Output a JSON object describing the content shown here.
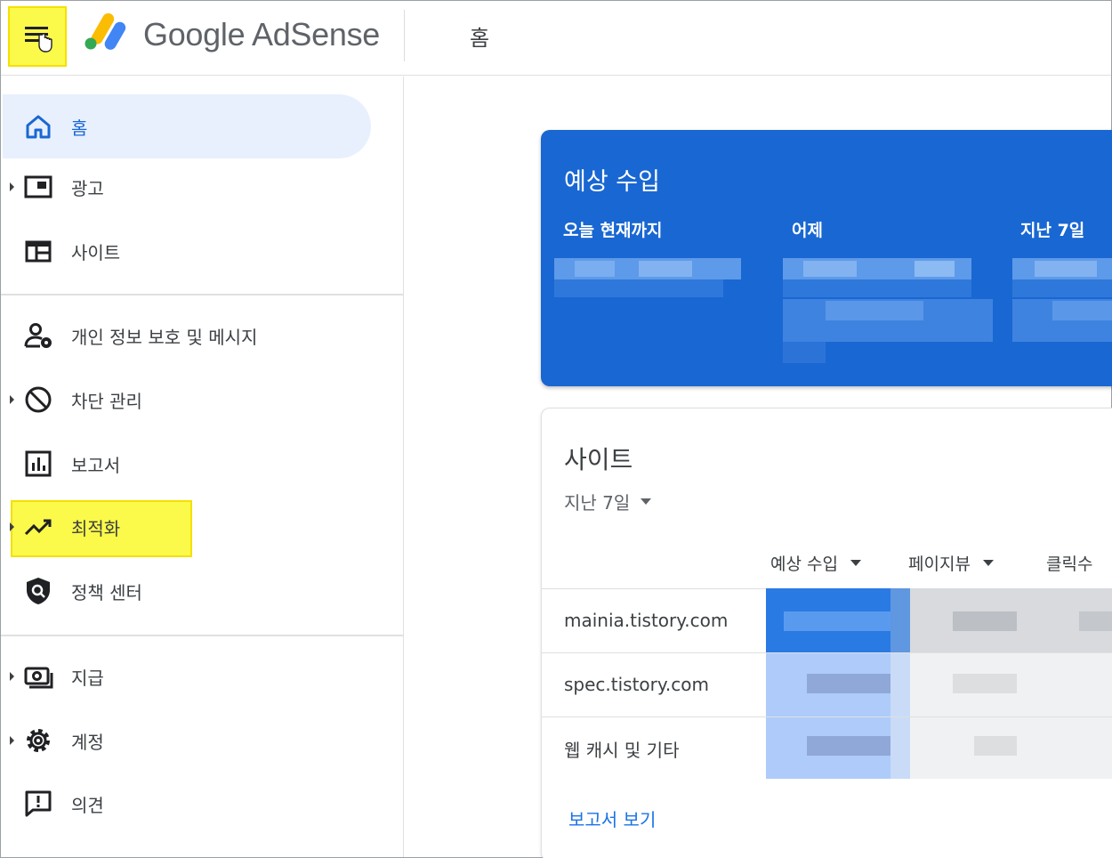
{
  "header": {
    "brand": "Google AdSense",
    "page_title": "홈"
  },
  "sidebar": {
    "items": [
      {
        "label": "홈",
        "icon": "home-icon"
      },
      {
        "label": "광고",
        "icon": "ads-icon"
      },
      {
        "label": "사이트",
        "icon": "sites-icon"
      },
      {
        "label": "개인 정보 보호 및 메시지",
        "icon": "privacy-icon"
      },
      {
        "label": "차단 관리",
        "icon": "block-icon"
      },
      {
        "label": "보고서",
        "icon": "reports-icon"
      },
      {
        "label": "최적화",
        "icon": "optimization-icon"
      },
      {
        "label": "정책 센터",
        "icon": "policy-icon"
      },
      {
        "label": "지급",
        "icon": "payments-icon"
      },
      {
        "label": "계정",
        "icon": "settings-icon"
      },
      {
        "label": "의견",
        "icon": "feedback-icon"
      }
    ]
  },
  "revenue_card": {
    "title": "예상 수입",
    "columns": [
      "오늘 현재까지",
      "어제",
      "지난 7일"
    ]
  },
  "sites_card": {
    "title": "사이트",
    "period": "지난 7일",
    "columns": [
      "예상 수입",
      "페이지뷰",
      "클릭수"
    ],
    "rows": [
      "mainia.tistory.com",
      "spec.tistory.com",
      "웹 캐시 및 기타"
    ],
    "report_link": "보고서 보기"
  },
  "colors": {
    "accent": "#1967d2",
    "highlight": "#fbf94a",
    "link": "#1a73e8"
  }
}
